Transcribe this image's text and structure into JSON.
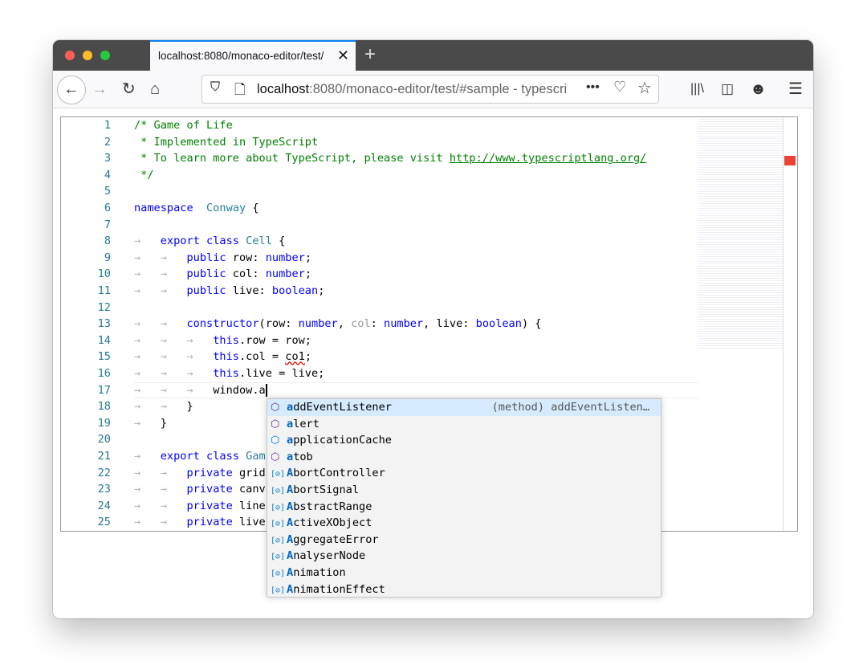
{
  "browser": {
    "tab_title": "localhost:8080/monaco-editor/test/",
    "url_host": "localhost",
    "url_rest": ":8080/monaco-editor/test/#sample - typescri"
  },
  "code_lines": [
    [
      [
        "c",
        "/* Game of Life"
      ]
    ],
    [
      [
        "c",
        " * Implemented in TypeScript"
      ]
    ],
    [
      [
        "c",
        " * To learn more about TypeScript, please visit "
      ],
      [
        "lnk",
        "http://www.typescriptlang.org/"
      ]
    ],
    [
      [
        "c",
        " */"
      ]
    ],
    [],
    [
      [
        "k",
        "namespace"
      ],
      [
        "",
        "  "
      ],
      [
        "ty",
        "Conway"
      ],
      [
        "",
        " {"
      ]
    ],
    [],
    [
      [
        "w",
        "→   "
      ],
      [
        "k",
        "export class "
      ],
      [
        "ty",
        "Cell"
      ],
      [
        "",
        " {"
      ]
    ],
    [
      [
        "w",
        "→   →   "
      ],
      [
        "k",
        "public "
      ],
      [
        "",
        "row: "
      ],
      [
        "k",
        "number"
      ],
      [
        "",
        ";"
      ]
    ],
    [
      [
        "w",
        "→   →   "
      ],
      [
        "k",
        "public "
      ],
      [
        "",
        "col: "
      ],
      [
        "k",
        "number"
      ],
      [
        "",
        ";"
      ]
    ],
    [
      [
        "w",
        "→   →   "
      ],
      [
        "k",
        "public "
      ],
      [
        "",
        "live: "
      ],
      [
        "k",
        "boolean"
      ],
      [
        "",
        ";"
      ]
    ],
    [],
    [
      [
        "w",
        "→   →   "
      ],
      [
        "k",
        "constructor"
      ],
      [
        "",
        "(row: "
      ],
      [
        "k",
        "number"
      ],
      [
        "",
        ", "
      ],
      [
        "g",
        "col"
      ],
      [
        "",
        ": "
      ],
      [
        "k",
        "number"
      ],
      [
        "",
        ", live: "
      ],
      [
        "k",
        "boolean"
      ],
      [
        "",
        ") {"
      ]
    ],
    [
      [
        "w",
        "→   →   →   "
      ],
      [
        "k",
        "this"
      ],
      [
        "",
        ".row = row;"
      ]
    ],
    [
      [
        "w",
        "→   →   →   "
      ],
      [
        "k",
        "this"
      ],
      [
        "",
        ".col = "
      ],
      [
        "sq",
        "co1"
      ],
      [
        "",
        ";"
      ]
    ],
    [
      [
        "w",
        "→   →   →   "
      ],
      [
        "k",
        "this"
      ],
      [
        "",
        ".live = live;"
      ]
    ],
    [
      [
        "w",
        "→   →   →   "
      ],
      [
        "",
        "window."
      ],
      [
        "cur",
        "a"
      ]
    ],
    [
      [
        "w",
        "→   →   "
      ],
      [
        "",
        "}"
      ]
    ],
    [
      [
        "w",
        "→   "
      ],
      [
        "",
        "}"
      ]
    ],
    [],
    [
      [
        "w",
        "→   "
      ],
      [
        "k",
        "export class "
      ],
      [
        "ty",
        "Gam"
      ]
    ],
    [
      [
        "w",
        "→   →   "
      ],
      [
        "k",
        "private "
      ],
      [
        "",
        "grid"
      ]
    ],
    [
      [
        "w",
        "→   →   "
      ],
      [
        "k",
        "private "
      ],
      [
        "",
        "canv"
      ]
    ],
    [
      [
        "w",
        "→   →   "
      ],
      [
        "k",
        "private "
      ],
      [
        "",
        "line"
      ]
    ],
    [
      [
        "w",
        "→   →   "
      ],
      [
        "k",
        "private "
      ],
      [
        "",
        "live"
      ]
    ]
  ],
  "suggestions": [
    {
      "icon": "method",
      "hl": "a",
      "rest": "ddEventListener",
      "detail": "(method) addEventListen…",
      "selected": true
    },
    {
      "icon": "method",
      "hl": "a",
      "rest": "lert"
    },
    {
      "icon": "property",
      "hl": "a",
      "rest": "pplicationCache"
    },
    {
      "icon": "method",
      "hl": "a",
      "rest": "tob"
    },
    {
      "icon": "variable",
      "hl": "A",
      "rest": "bortController"
    },
    {
      "icon": "variable",
      "hl": "A",
      "rest": "bortSignal"
    },
    {
      "icon": "variable",
      "hl": "A",
      "rest": "bstractRange"
    },
    {
      "icon": "variable",
      "hl": "A",
      "rest": "ctiveXObject"
    },
    {
      "icon": "variable",
      "hl": "A",
      "rest": "ggregateError"
    },
    {
      "icon": "variable",
      "hl": "A",
      "rest": "nalyserNode"
    },
    {
      "icon": "variable",
      "hl": "A",
      "rest": "nimation"
    },
    {
      "icon": "variable",
      "hl": "A",
      "rest": "nimationEffect"
    }
  ]
}
